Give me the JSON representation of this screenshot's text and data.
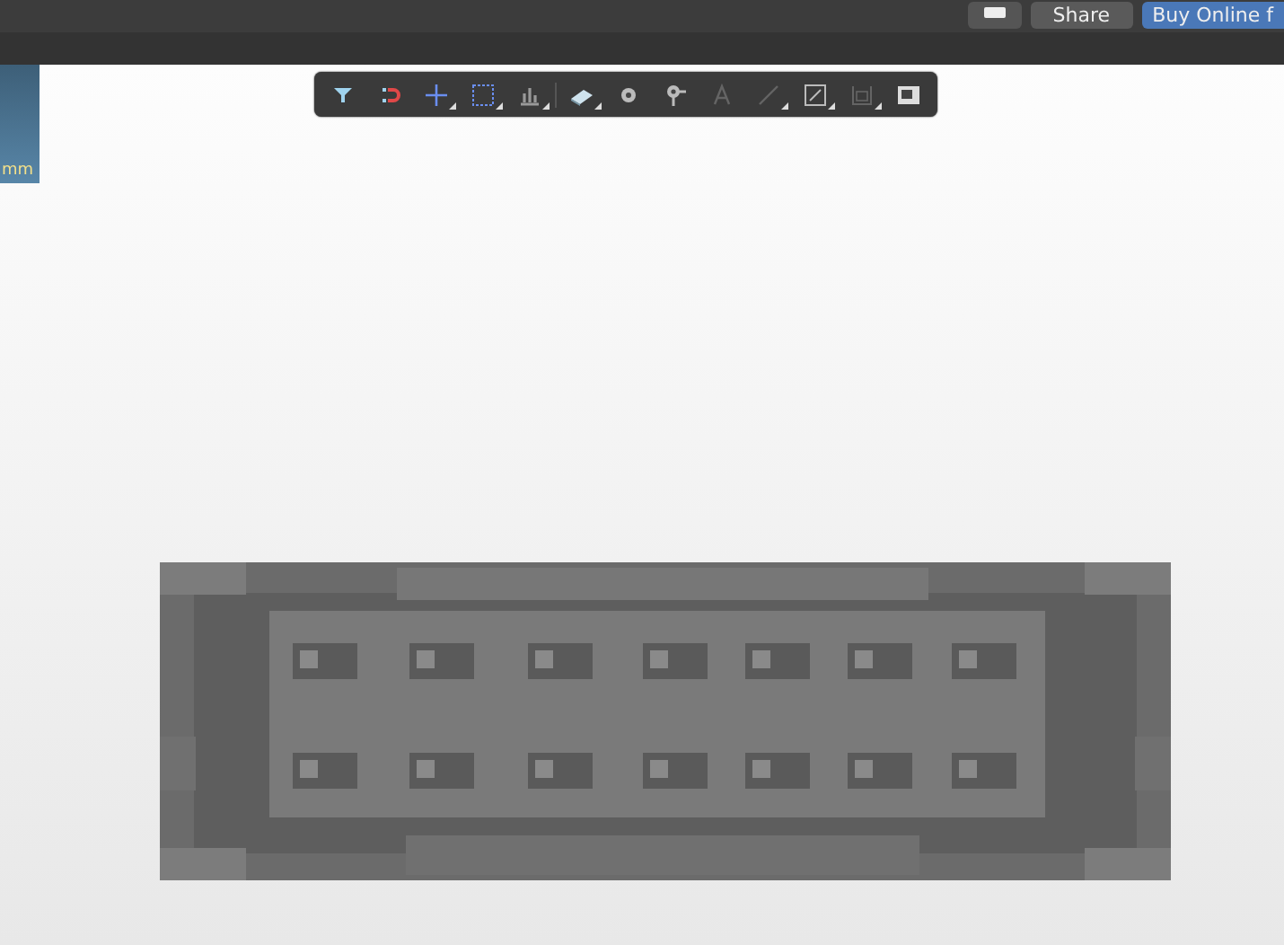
{
  "header": {
    "buttons": [
      {
        "kind": "comment"
      },
      {
        "kind": "share",
        "label": "Share"
      },
      {
        "kind": "buy",
        "label": "Buy Online f"
      }
    ]
  },
  "side_panel": {
    "label": "mm"
  },
  "toolbar": {
    "tools": [
      {
        "kind": "filter",
        "has_menu": false,
        "disabled": false
      },
      {
        "kind": "magnet",
        "has_menu": false,
        "disabled": false
      },
      {
        "kind": "crosshair",
        "has_menu": true,
        "disabled": false
      },
      {
        "kind": "select-box",
        "has_menu": true,
        "disabled": false
      },
      {
        "kind": "bars",
        "has_menu": true,
        "disabled": false
      },
      {
        "kind": "part",
        "has_menu": true,
        "disabled": false
      },
      {
        "kind": "dot",
        "has_menu": false,
        "disabled": false
      },
      {
        "kind": "pin",
        "has_menu": false,
        "disabled": false
      },
      {
        "kind": "text",
        "has_menu": false,
        "disabled": true
      },
      {
        "kind": "line",
        "has_menu": true,
        "disabled": true
      },
      {
        "kind": "measure",
        "has_menu": true,
        "disabled": false
      },
      {
        "kind": "frame",
        "has_menu": true,
        "disabled": true
      },
      {
        "kind": "window",
        "has_menu": false,
        "disabled": false
      }
    ]
  }
}
